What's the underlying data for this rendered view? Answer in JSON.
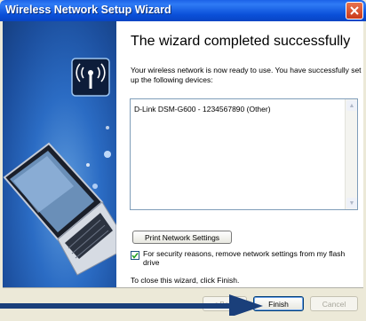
{
  "window": {
    "title": "Wireless Network Setup Wizard"
  },
  "wizard": {
    "heading": "The wizard completed successfully",
    "description": "Your wireless network is now ready to use. You have successfully set up the following devices:",
    "devices": [
      "D-Link DSM-G600 - 1234567890 (Other)"
    ],
    "print_button": "Print Network Settings",
    "security_checkbox": {
      "label": "For security reasons, remove network settings from my flash drive",
      "checked": true
    },
    "close_note": "To close this wizard, click Finish."
  },
  "footer": {
    "back_label": "< Back",
    "finish_label": "Finish",
    "cancel_label": "Cancel"
  },
  "colors": {
    "titlebar": "#0a4fd8",
    "left_panel": "#2b6cc4",
    "arrow": "#1a3f7a"
  },
  "icons": [
    "close-icon",
    "wireless-antenna-icon",
    "laptop-icon",
    "checkmark-icon",
    "scroll-up-icon",
    "scroll-down-icon",
    "pointer-arrow-icon"
  ]
}
